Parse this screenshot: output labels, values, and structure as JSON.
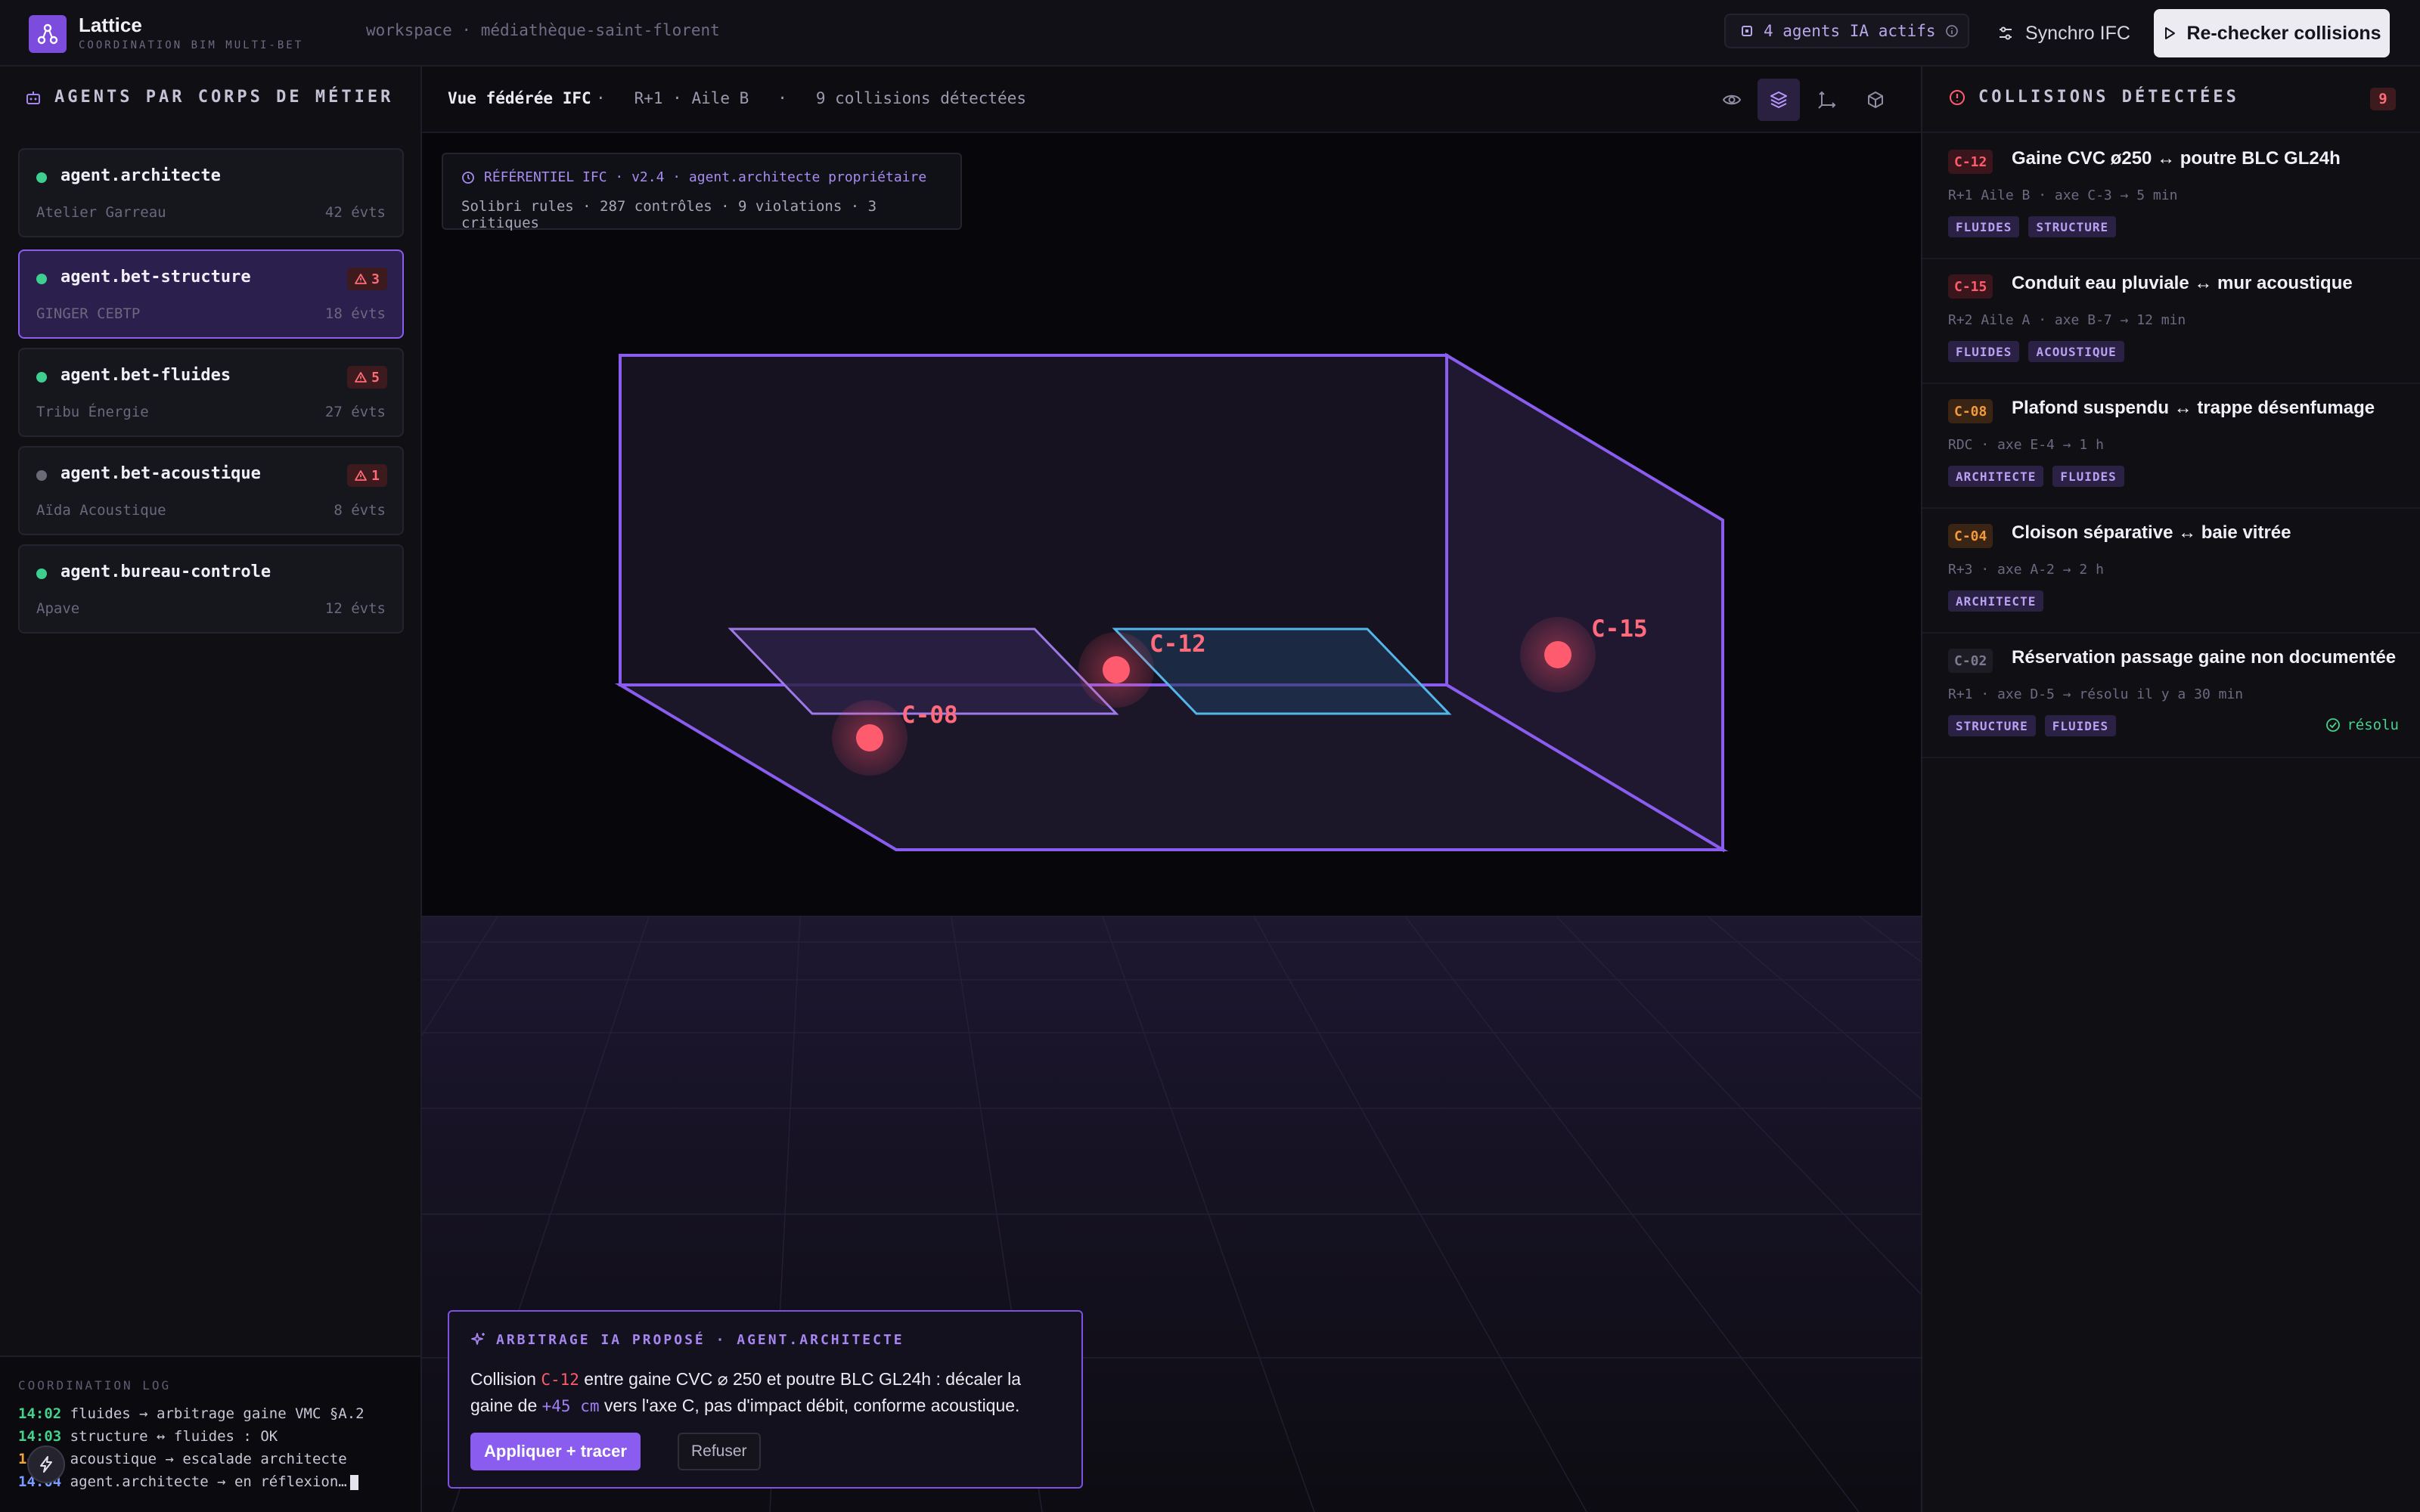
{
  "header": {
    "brand": "Lattice",
    "brand_sub": "COORDINATION BIM MULTI-BET",
    "breadcrumb": "workspace · médiathèque-saint-florent",
    "agents_status": "4 agents IA actifs",
    "synchro_label": "Synchro IFC",
    "recheck_label": "Re-checker collisions"
  },
  "sidebar": {
    "title": "AGENTS PAR CORPS DE MÉTIER",
    "agents": [
      {
        "name": "agent.architecte",
        "org": "Atelier Garreau",
        "events": "42 évts",
        "status_color": "#3ecf8e",
        "alerts": ""
      },
      {
        "name": "agent.bet-structure",
        "org": "GINGER CEBTP",
        "events": "18 évts",
        "status_color": "#3ecf8e",
        "alerts": "3"
      },
      {
        "name": "agent.bet-fluides",
        "org": "Tribu Énergie",
        "events": "27 évts",
        "status_color": "#3ecf8e",
        "alerts": "5"
      },
      {
        "name": "agent.bet-acoustique",
        "org": "Aïda Acoustique",
        "events": "8 évts",
        "status_color": "#6b6b78",
        "alerts": "1"
      },
      {
        "name": "agent.bureau-controle",
        "org": "Apave",
        "events": "12 évts",
        "status_color": "#3ecf8e",
        "alerts": ""
      }
    ],
    "log": {
      "title": "COORDINATION LOG",
      "lines": [
        {
          "time": "14:02",
          "text": "fluides → arbitrage gaine VMC §A.2"
        },
        {
          "time": "14:03",
          "text": "structure ↔ fluides : OK"
        },
        {
          "time": "14:03",
          "text": "acoustique → escalade architecte"
        },
        {
          "time": "14:04",
          "text": "agent.architecte → en réflexion…"
        }
      ]
    }
  },
  "viewer": {
    "title": "Vue fédérée IFC",
    "location": "R+1 · Aile B",
    "collisions_count": "9 collisions détectées",
    "separator": "·",
    "ifc_line1": "RÉFÉRENTIEL IFC · v2.4 · agent.architecte propriétaire",
    "ifc_line2": "Solibri rules · 287 contrôles · 9 violations · 3 critiques",
    "markers": [
      "C-08",
      "C-12",
      "C-15"
    ],
    "arbitration": {
      "title": "ARBITRAGE IA PROPOSÉ · AGENT.ARCHITECTE",
      "text_1": "Collision ",
      "code": "C-12",
      "text_2": " entre gaine CVC ⌀ 250 et poutre BLC GL24h : décaler la gaine de ",
      "offset": "+45 cm",
      "text_3": " vers l'axe C, pas d'impact débit, conforme acoustique.",
      "apply_label": "Appliquer + tracer",
      "refuse_label": "Refuser"
    }
  },
  "collisions": {
    "title": "COLLISIONS DÉTECTÉES",
    "count": "9",
    "items": [
      {
        "code": "C-12",
        "title": "Gaine CVC ø250 ↔ poutre BLC GL24h",
        "meta": "R+1 Aile B · axe C-3 → 5 min",
        "tags": [
          "FLUIDES",
          "STRUCTURE"
        ],
        "severity": "critical",
        "resolved": ""
      },
      {
        "code": "C-15",
        "title": "Conduit eau pluviale ↔ mur acoustique",
        "meta": "R+2 Aile A · axe B-7 → 12 min",
        "tags": [
          "FLUIDES",
          "ACOUSTIQUE"
        ],
        "severity": "critical",
        "resolved": ""
      },
      {
        "code": "C-08",
        "title": "Plafond suspendu ↔ trappe désenfumage",
        "meta": "RDC · axe E-4 → 1 h",
        "tags": [
          "ARCHITECTE",
          "FLUIDES"
        ],
        "severity": "major",
        "resolved": ""
      },
      {
        "code": "C-04",
        "title": "Cloison séparative ↔ baie vitrée",
        "meta": "R+3 · axe A-2 → 2 h",
        "tags": [
          "ARCHITECTE"
        ],
        "severity": "major",
        "resolved": ""
      },
      {
        "code": "C-02",
        "title": "Réservation passage gaine non documentée",
        "meta": "R+1 · axe D-5 → résolu il y a 30 min",
        "tags": [
          "STRUCTURE",
          "FLUIDES"
        ],
        "severity": "resolved",
        "resolved": "résolu"
      }
    ]
  }
}
